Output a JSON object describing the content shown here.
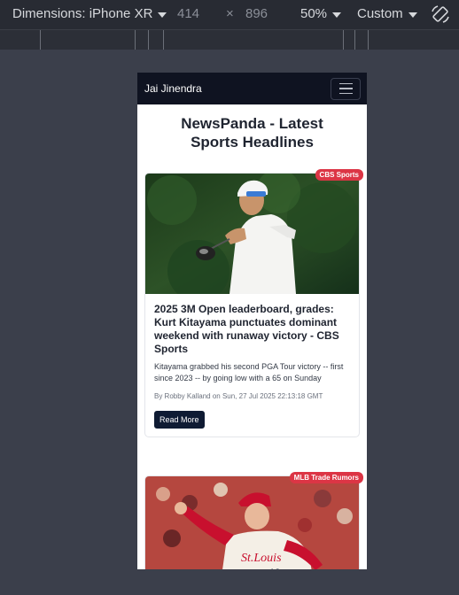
{
  "toolbar": {
    "dimensions_label": "Dimensions: iPhone XR",
    "width": "414",
    "times": "×",
    "height": "896",
    "zoom": "50%",
    "throttle": "Custom"
  },
  "app": {
    "brand": "Jai Jinendra",
    "heading": "NewsPanda - Latest Sports Headlines"
  },
  "articles": [
    {
      "source": "CBS Sports",
      "title": "2025 3M Open leaderboard, grades: Kurt Kitayama punctuates dominant weekend with runaway victory - CBS Sports",
      "description": "Kitayama grabbed his second PGA Tour victory -- first since 2023 -- by going low with a 65 on Sunday",
      "meta": "By Robby Kalland on Sun, 27 Jul 2025 22:13:18 GMT",
      "button": "Read More"
    },
    {
      "source": "MLB Trade Rumors"
    }
  ],
  "colors": {
    "navbar": "#0f1321",
    "badge": "#dc3545",
    "button": "#0f1b33"
  }
}
